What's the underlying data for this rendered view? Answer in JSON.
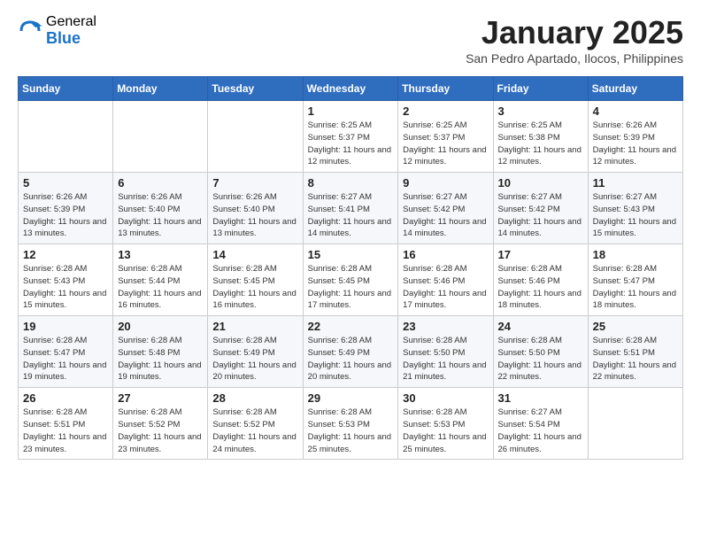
{
  "logo": {
    "general": "General",
    "blue": "Blue"
  },
  "title": {
    "month": "January 2025",
    "location": "San Pedro Apartado, Ilocos, Philippines"
  },
  "weekdays": [
    "Sunday",
    "Monday",
    "Tuesday",
    "Wednesday",
    "Thursday",
    "Friday",
    "Saturday"
  ],
  "weeks": [
    [
      {
        "day": "",
        "info": ""
      },
      {
        "day": "",
        "info": ""
      },
      {
        "day": "",
        "info": ""
      },
      {
        "day": "1",
        "info": "Sunrise: 6:25 AM\nSunset: 5:37 PM\nDaylight: 11 hours and 12 minutes."
      },
      {
        "day": "2",
        "info": "Sunrise: 6:25 AM\nSunset: 5:37 PM\nDaylight: 11 hours and 12 minutes."
      },
      {
        "day": "3",
        "info": "Sunrise: 6:25 AM\nSunset: 5:38 PM\nDaylight: 11 hours and 12 minutes."
      },
      {
        "day": "4",
        "info": "Sunrise: 6:26 AM\nSunset: 5:39 PM\nDaylight: 11 hours and 12 minutes."
      }
    ],
    [
      {
        "day": "5",
        "info": "Sunrise: 6:26 AM\nSunset: 5:39 PM\nDaylight: 11 hours and 13 minutes."
      },
      {
        "day": "6",
        "info": "Sunrise: 6:26 AM\nSunset: 5:40 PM\nDaylight: 11 hours and 13 minutes."
      },
      {
        "day": "7",
        "info": "Sunrise: 6:26 AM\nSunset: 5:40 PM\nDaylight: 11 hours and 13 minutes."
      },
      {
        "day": "8",
        "info": "Sunrise: 6:27 AM\nSunset: 5:41 PM\nDaylight: 11 hours and 14 minutes."
      },
      {
        "day": "9",
        "info": "Sunrise: 6:27 AM\nSunset: 5:42 PM\nDaylight: 11 hours and 14 minutes."
      },
      {
        "day": "10",
        "info": "Sunrise: 6:27 AM\nSunset: 5:42 PM\nDaylight: 11 hours and 14 minutes."
      },
      {
        "day": "11",
        "info": "Sunrise: 6:27 AM\nSunset: 5:43 PM\nDaylight: 11 hours and 15 minutes."
      }
    ],
    [
      {
        "day": "12",
        "info": "Sunrise: 6:28 AM\nSunset: 5:43 PM\nDaylight: 11 hours and 15 minutes."
      },
      {
        "day": "13",
        "info": "Sunrise: 6:28 AM\nSunset: 5:44 PM\nDaylight: 11 hours and 16 minutes."
      },
      {
        "day": "14",
        "info": "Sunrise: 6:28 AM\nSunset: 5:45 PM\nDaylight: 11 hours and 16 minutes."
      },
      {
        "day": "15",
        "info": "Sunrise: 6:28 AM\nSunset: 5:45 PM\nDaylight: 11 hours and 17 minutes."
      },
      {
        "day": "16",
        "info": "Sunrise: 6:28 AM\nSunset: 5:46 PM\nDaylight: 11 hours and 17 minutes."
      },
      {
        "day": "17",
        "info": "Sunrise: 6:28 AM\nSunset: 5:46 PM\nDaylight: 11 hours and 18 minutes."
      },
      {
        "day": "18",
        "info": "Sunrise: 6:28 AM\nSunset: 5:47 PM\nDaylight: 11 hours and 18 minutes."
      }
    ],
    [
      {
        "day": "19",
        "info": "Sunrise: 6:28 AM\nSunset: 5:47 PM\nDaylight: 11 hours and 19 minutes."
      },
      {
        "day": "20",
        "info": "Sunrise: 6:28 AM\nSunset: 5:48 PM\nDaylight: 11 hours and 19 minutes."
      },
      {
        "day": "21",
        "info": "Sunrise: 6:28 AM\nSunset: 5:49 PM\nDaylight: 11 hours and 20 minutes."
      },
      {
        "day": "22",
        "info": "Sunrise: 6:28 AM\nSunset: 5:49 PM\nDaylight: 11 hours and 20 minutes."
      },
      {
        "day": "23",
        "info": "Sunrise: 6:28 AM\nSunset: 5:50 PM\nDaylight: 11 hours and 21 minutes."
      },
      {
        "day": "24",
        "info": "Sunrise: 6:28 AM\nSunset: 5:50 PM\nDaylight: 11 hours and 22 minutes."
      },
      {
        "day": "25",
        "info": "Sunrise: 6:28 AM\nSunset: 5:51 PM\nDaylight: 11 hours and 22 minutes."
      }
    ],
    [
      {
        "day": "26",
        "info": "Sunrise: 6:28 AM\nSunset: 5:51 PM\nDaylight: 11 hours and 23 minutes."
      },
      {
        "day": "27",
        "info": "Sunrise: 6:28 AM\nSunset: 5:52 PM\nDaylight: 11 hours and 23 minutes."
      },
      {
        "day": "28",
        "info": "Sunrise: 6:28 AM\nSunset: 5:52 PM\nDaylight: 11 hours and 24 minutes."
      },
      {
        "day": "29",
        "info": "Sunrise: 6:28 AM\nSunset: 5:53 PM\nDaylight: 11 hours and 25 minutes."
      },
      {
        "day": "30",
        "info": "Sunrise: 6:28 AM\nSunset: 5:53 PM\nDaylight: 11 hours and 25 minutes."
      },
      {
        "day": "31",
        "info": "Sunrise: 6:27 AM\nSunset: 5:54 PM\nDaylight: 11 hours and 26 minutes."
      },
      {
        "day": "",
        "info": ""
      }
    ]
  ]
}
